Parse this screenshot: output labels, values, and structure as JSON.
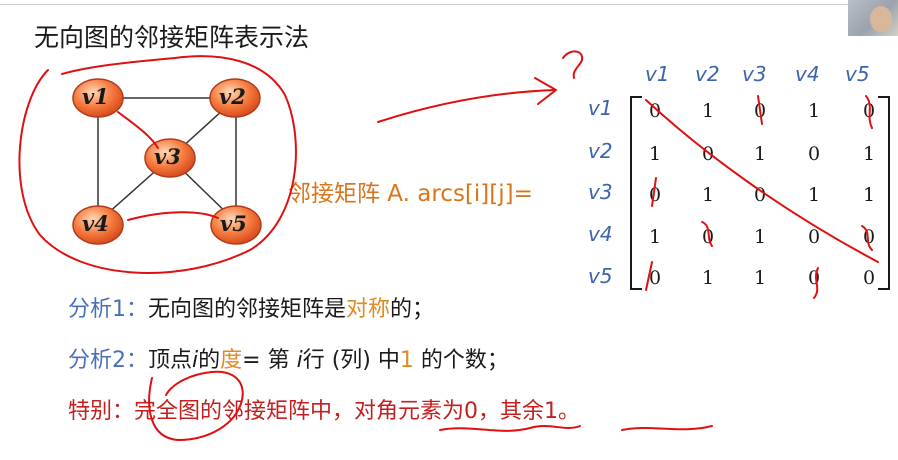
{
  "slide": {
    "title": "无向图的邻接矩阵表示法",
    "matrix_label": "邻接矩阵 A. arcs[i][j]=",
    "column_headers": [
      "v1",
      "v2",
      "v3",
      "v4",
      "v5"
    ],
    "row_headers": [
      "v1",
      "v2",
      "v3",
      "v4",
      "v5"
    ],
    "matrix": [
      [
        "0",
        "1",
        "0",
        "1",
        "0"
      ],
      [
        "1",
        "0",
        "1",
        "0",
        "1"
      ],
      [
        "0",
        "1",
        "0",
        "1",
        "1"
      ],
      [
        "1",
        "0",
        "1",
        "0",
        "0"
      ],
      [
        "0",
        "1",
        "1",
        "0",
        "0"
      ]
    ],
    "vertices": [
      "v1",
      "v2",
      "v3",
      "v4",
      "v5"
    ],
    "analysis1": {
      "label": "分析1：",
      "text_before": "无向图的邻接矩阵是",
      "highlight": "对称",
      "text_after": "的；"
    },
    "analysis2": {
      "label": "分析2：",
      "t1": "顶点",
      "i1": "i",
      "t2": "的",
      "hl1": "度",
      "t3": "= 第 ",
      "i2": "i",
      "t4": "行 (列) 中",
      "hl2": "1",
      "t5": " 的个数；"
    },
    "special": {
      "label": "特别：",
      "text": "完全图的邻接矩阵中，对角元素为0，其余1。"
    }
  },
  "colors": {
    "orange": "#e08a26",
    "blue": "#4a6fb8",
    "red": "#c41f1f",
    "vertex_fill": "#f05a22"
  }
}
